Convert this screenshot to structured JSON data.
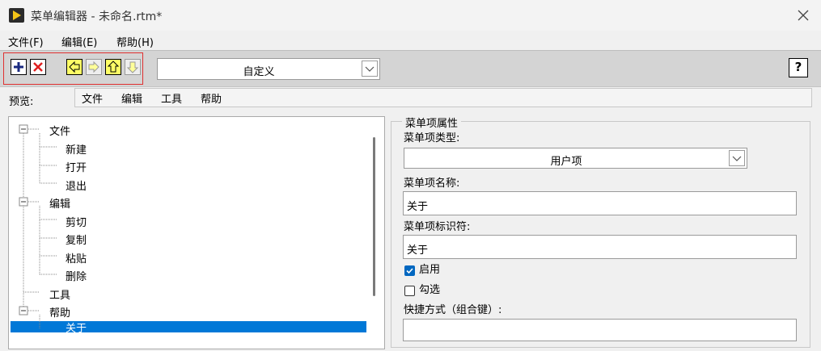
{
  "window": {
    "title": "菜单编辑器 - 未命名.rtm*"
  },
  "menubar": {
    "items": [
      "文件(F)",
      "编辑(E)",
      "帮助(H)"
    ]
  },
  "toolbar": {
    "menu_type_select": "自定义",
    "help_label": "?"
  },
  "preview": {
    "label": "预览:",
    "items": [
      "文件",
      "编辑",
      "工具",
      "帮助"
    ]
  },
  "tree": {
    "nodes": [
      "文件",
      "新建",
      "打开",
      "退出",
      "编辑",
      "剪切",
      "复制",
      "粘贴",
      "删除",
      "工具",
      "帮助",
      "关于"
    ],
    "selected": "关于"
  },
  "properties": {
    "group_title": "菜单项属性",
    "item_type_label": "菜单项类型:",
    "item_type_value": "用户项",
    "item_name_label": "菜单项名称:",
    "item_name_value": "关于",
    "item_id_label": "菜单项标识符:",
    "item_id_value": "关于",
    "enabled_label": "启用",
    "enabled": true,
    "checked_label": "勾选",
    "checked": false,
    "shortcut_label": "快捷方式（组合键）:",
    "shortcut_value": ""
  },
  "colors": {
    "selection": "#0078d7",
    "toolbar_highlight": "#e03030",
    "arrow_fill": "#ffff66"
  }
}
